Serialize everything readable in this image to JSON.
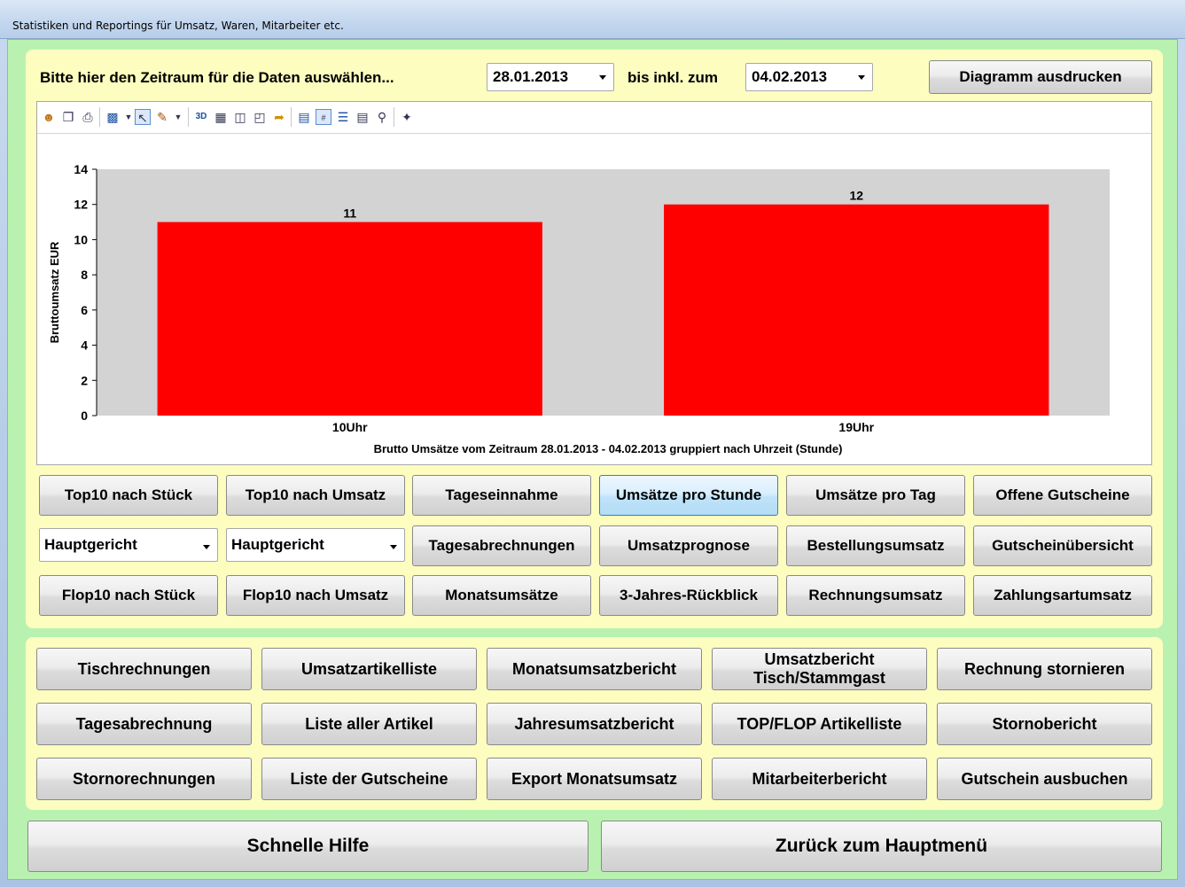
{
  "window": {
    "title": "Statistiken und Reportings für Umsatz, Waren, Mitarbeiter etc."
  },
  "range": {
    "label": "Bitte hier den Zeitraum für die Daten auswählen...",
    "from_date": "28.01.2013",
    "to_label": "bis inkl. zum",
    "to_date": "04.02.2013",
    "print_button": "Diagramm ausdrucken"
  },
  "toolbar": {
    "icons": [
      "users-icon",
      "copy-icon",
      "print-icon",
      "bar-chart-icon",
      "dropdown-arrow-icon",
      "pointer-icon",
      "pen-icon",
      "dropdown-arrow-icon",
      "3d-icon",
      "grid-icon",
      "split-horizontal-icon",
      "split-vertical-icon",
      "export-icon",
      "chart-settings-icon",
      "data-labels-icon",
      "legend-icon",
      "list-icon",
      "zoom-icon",
      "wizard-icon"
    ]
  },
  "chart_data": {
    "type": "bar",
    "categories": [
      "10Uhr",
      "19Uhr"
    ],
    "values": [
      11,
      12
    ],
    "data_labels": [
      "11",
      "12"
    ],
    "title": "",
    "xlabel": "Brutto Umsätze vom Zeitraum 28.01.2013 - 04.02.2013 gruppiert nach Uhrzeit (Stunde)",
    "ylabel": "Bruttoumsatz EUR",
    "ylim": [
      0,
      14
    ],
    "yticks": [
      "0",
      "2",
      "4",
      "6",
      "8",
      "10",
      "12",
      "14"
    ],
    "bar_color": "#ff0000",
    "plot_background": "#d3d3d3",
    "grid": false,
    "legend": "none"
  },
  "report_buttons": {
    "row1": [
      "Top10 nach Stück",
      "Top10 nach Umsatz",
      "Tageseinnahme",
      "Umsätze pro Stunde",
      "Umsätze pro Tag",
      "Offene Gutscheine"
    ],
    "row2_selects": [
      "Hauptgericht",
      "Hauptgericht"
    ],
    "row2": [
      "Tagesabrechnungen",
      "Umsatzprognose",
      "Bestellungsumsatz",
      "Gutscheinübersicht"
    ],
    "row3": [
      "Flop10 nach Stück",
      "Flop10 nach Umsatz",
      "Monatsumsätze",
      "3-Jahres-Rückblick",
      "Rechnungsumsatz",
      "Zahlungsartumsatz"
    ]
  },
  "list_buttons": {
    "row1": [
      "Tischrechnungen",
      "Umsatzartikelliste",
      "Monatsumsatzbericht",
      "Umsatzbericht",
      "Tisch/Stammgast",
      "Rechnung stornieren"
    ],
    "row2": [
      "Tagesabrechnung",
      "Liste aller Artikel",
      "Jahresumsatzbericht",
      "TOP/FLOP Artikelliste",
      "Stornobericht"
    ],
    "row3": [
      "Stornorechnungen",
      "Liste der Gutscheine",
      "Export Monatsumsatz",
      "Mitarbeiterbericht",
      "Gutschein ausbuchen"
    ]
  },
  "footer": {
    "help": "Schnelle Hilfe",
    "back": "Zurück zum Hauptmenü"
  },
  "colors": {
    "background": "#b9f2b0",
    "panel": "#fdfdc0",
    "active_button": "#bfe3fa",
    "bar": "#ff0000"
  }
}
